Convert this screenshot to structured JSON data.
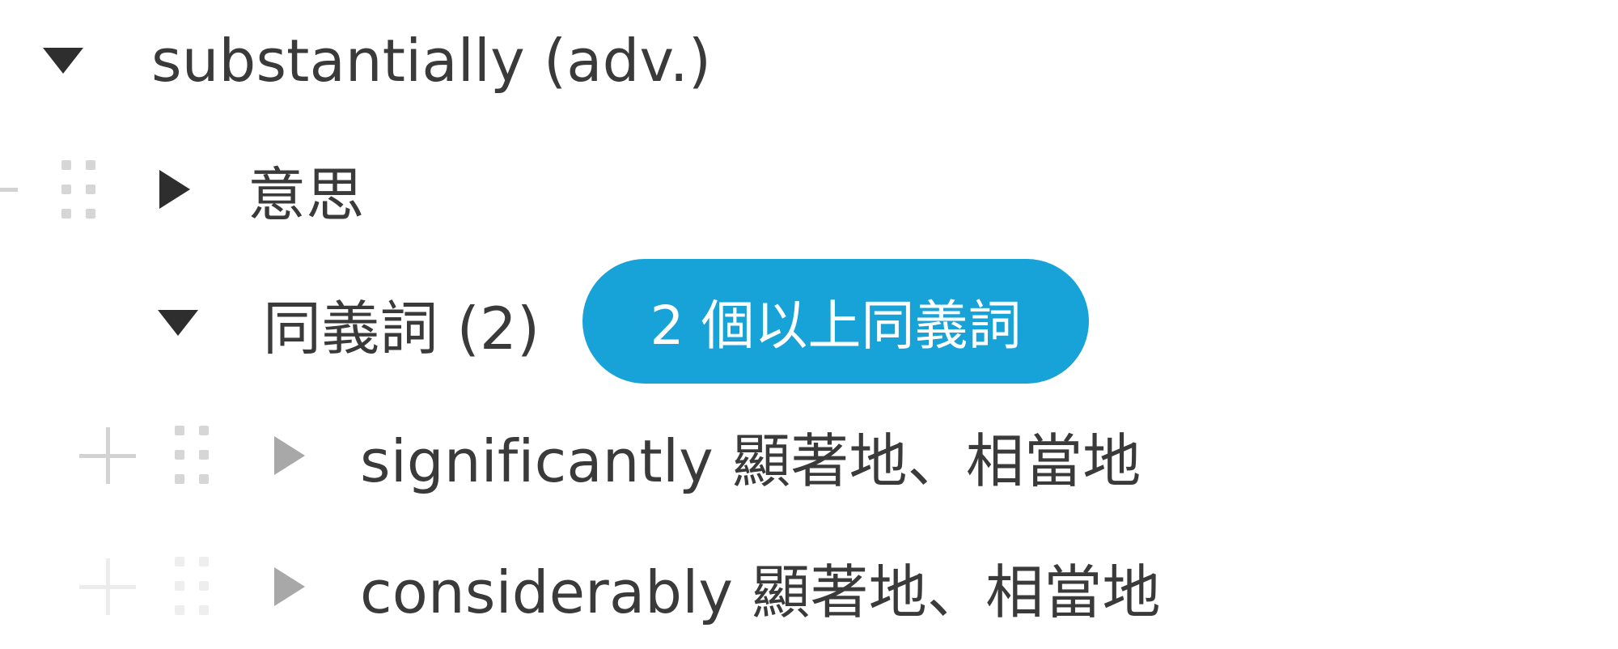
{
  "tree": {
    "root": {
      "label": "substantially (adv.)",
      "expanded": true
    },
    "children": [
      {
        "label": "意思",
        "expanded": false
      },
      {
        "label": "同義詞 (2)",
        "expanded": true,
        "badge": "2 個以上同義詞",
        "items": [
          {
            "label": "significantly 顯著地、相當地"
          },
          {
            "label": "considerably 顯著地、相當地"
          }
        ]
      }
    ]
  },
  "colors": {
    "badge": "#17a2d8",
    "text": "#3a3a3a",
    "muted": "#a8a8a8"
  },
  "icons": {
    "expanded": "triangle-down-icon",
    "collapsed": "triangle-right-icon",
    "add": "plus-icon",
    "drag": "drag-handle-icon"
  }
}
